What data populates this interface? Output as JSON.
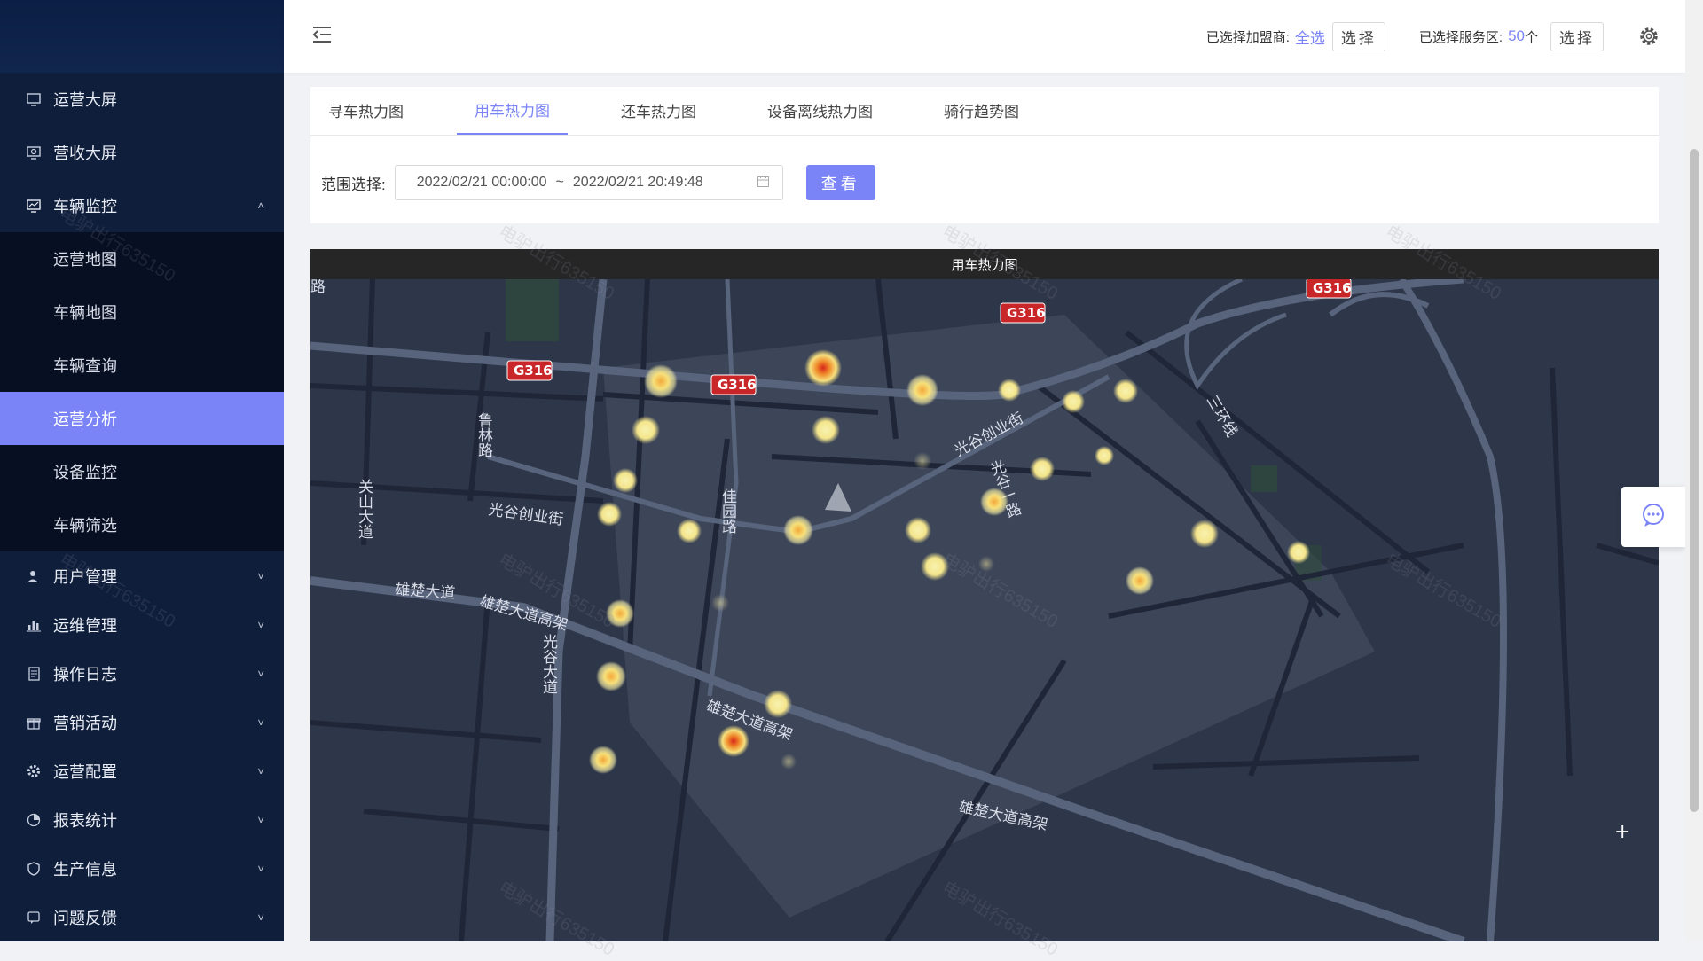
{
  "sidebar": {
    "items": [
      {
        "label": "运营大屏",
        "icon": "monitor-icon"
      },
      {
        "label": "营收大屏",
        "icon": "revenue-monitor-icon"
      },
      {
        "label": "车辆监控",
        "icon": "vehicle-monitor-icon",
        "expanded": true
      }
    ],
    "submenu": [
      {
        "label": "运营地图"
      },
      {
        "label": "车辆地图"
      },
      {
        "label": "车辆查询"
      },
      {
        "label": "运营分析",
        "active": true
      },
      {
        "label": "设备监控"
      },
      {
        "label": "车辆筛选"
      }
    ],
    "bottom_items": [
      {
        "label": "用户管理",
        "icon": "user-icon"
      },
      {
        "label": "运维管理",
        "icon": "bar-chart-icon"
      },
      {
        "label": "操作日志",
        "icon": "document-icon"
      },
      {
        "label": "营销活动",
        "icon": "gift-icon"
      },
      {
        "label": "运营配置",
        "icon": "gear-icon"
      },
      {
        "label": "报表统计",
        "icon": "pie-chart-icon"
      },
      {
        "label": "生产信息",
        "icon": "shield-icon"
      },
      {
        "label": "问题反馈",
        "icon": "feedback-icon"
      }
    ]
  },
  "header": {
    "franchise_label": "已选择加盟商:",
    "franchise_value": "全选",
    "franchise_button": "选择",
    "service_label": "已选择服务区:",
    "service_value": "50",
    "service_unit": "个",
    "service_button": "选择"
  },
  "tabs": [
    {
      "label": "寻车热力图"
    },
    {
      "label": "用车热力图",
      "active": true
    },
    {
      "label": "还车热力图"
    },
    {
      "label": "设备离线热力图"
    },
    {
      "label": "骑行趋势图"
    }
  ],
  "filter": {
    "label": "范围选择:",
    "start": "2022/02/21 00:00:00",
    "separator": "~",
    "end": "2022/02/21 20:49:48",
    "query_button": "查看"
  },
  "map": {
    "title": "用车热力图",
    "road_labels": [
      "G316",
      "G316",
      "G316",
      "G316",
      "光谷创业街",
      "光谷创业街",
      "光谷一路",
      "佳园路",
      "鲁林路",
      "关山大道",
      "雄楚大道",
      "雄楚大道高架",
      "雄楚大道高架",
      "雄楚大道高架",
      "光谷大道",
      "三环线",
      "路"
    ]
  },
  "watermark": "电驴出行635150",
  "colors": {
    "accent": "#7b84f7",
    "sidebar": "#0f1e3a",
    "map_bg": "#2b3347"
  }
}
